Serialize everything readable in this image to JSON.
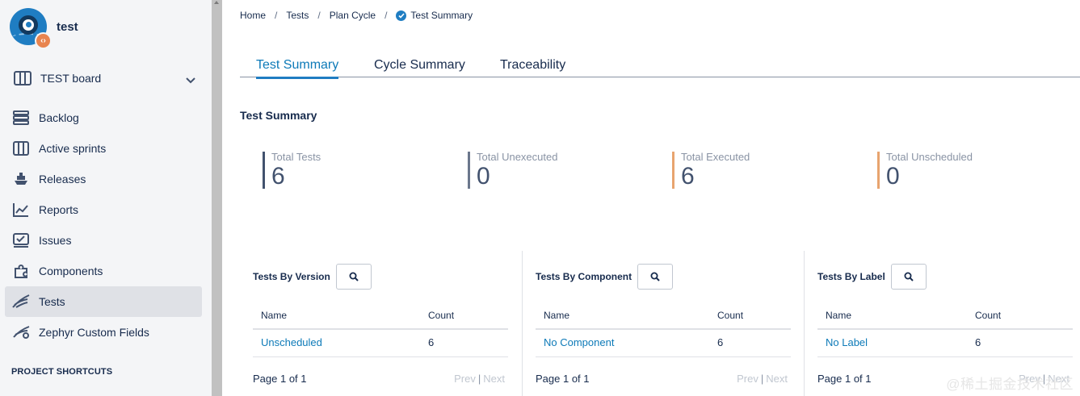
{
  "project": {
    "name": "test",
    "badge_icon": "code-icon"
  },
  "board": {
    "label": "TEST board"
  },
  "sidebar": {
    "items": [
      {
        "label": "Backlog",
        "icon": "backlog-icon"
      },
      {
        "label": "Active sprints",
        "icon": "board-icon"
      },
      {
        "label": "Releases",
        "icon": "ship-icon"
      },
      {
        "label": "Reports",
        "icon": "chart-icon"
      },
      {
        "label": "Issues",
        "icon": "issues-icon"
      },
      {
        "label": "Components",
        "icon": "puzzle-icon"
      },
      {
        "label": "Tests",
        "icon": "wings-icon",
        "active": true
      },
      {
        "label": "Zephyr Custom Fields",
        "icon": "zephyr-icon"
      }
    ],
    "shortcuts_heading": "PROJECT SHORTCUTS"
  },
  "breadcrumb": {
    "home": "Home",
    "tests": "Tests",
    "plan_cycle": "Plan Cycle",
    "current": "Test Summary",
    "sep": "/"
  },
  "tabs": [
    {
      "label": "Test Summary",
      "active": true
    },
    {
      "label": "Cycle Summary"
    },
    {
      "label": "Traceability"
    }
  ],
  "summary": {
    "title": "Test Summary",
    "stats": [
      {
        "label": "Total Tests",
        "value": "6",
        "color": "#42526e"
      },
      {
        "label": "Total Unexecuted",
        "value": "0",
        "color": "#6b778c"
      },
      {
        "label": "Total Executed",
        "value": "6",
        "color": "#e8a46f"
      },
      {
        "label": "Total Unscheduled",
        "value": "0",
        "color": "#e8a46f"
      }
    ]
  },
  "panels": [
    {
      "title": "Tests By Version",
      "col_name": "Name",
      "col_count": "Count",
      "rows": [
        {
          "name": "Unscheduled",
          "count": "6"
        }
      ],
      "page": "Page 1 of 1",
      "prev": "Prev",
      "next": "Next"
    },
    {
      "title": "Tests By Component",
      "col_name": "Name",
      "col_count": "Count",
      "rows": [
        {
          "name": "No Component",
          "count": "6"
        }
      ],
      "page": "Page 1 of 1",
      "prev": "Prev",
      "next": "Next"
    },
    {
      "title": "Tests By Label",
      "col_name": "Name",
      "col_count": "Count",
      "rows": [
        {
          "name": "No Label",
          "count": "6"
        }
      ],
      "page": "Page 1 of 1",
      "prev": "Prev",
      "next": "Next"
    }
  ],
  "watermark": "@稀土掘金技术社区",
  "colors": {
    "accent": "#0d7ab8",
    "sidebar_bg": "#f4f5f7",
    "active_bg": "#dfe1e6"
  }
}
